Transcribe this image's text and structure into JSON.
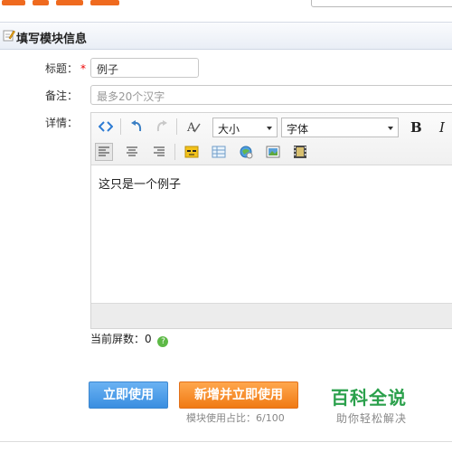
{
  "section": {
    "title": "填写模块信息"
  },
  "form": {
    "title_label": "标题：",
    "required_mark": "*",
    "title_value": "例子",
    "note_label": "备注：",
    "note_placeholder": "最多20个汉字",
    "detail_label": "详情："
  },
  "editor": {
    "size_select": "大小",
    "font_select": "字体",
    "bold": "B",
    "italic": "I",
    "content": "这只是一个例子",
    "icons": [
      "source-icon",
      "undo-icon",
      "redo-icon",
      "clear-format-icon",
      "align-left-icon",
      "align-center-icon",
      "align-right-icon",
      "emoticon-icon",
      "table-icon",
      "image-icon",
      "picture-icon",
      "video-icon"
    ]
  },
  "status": {
    "screens_label": "当前屏数：",
    "screens_value": "0",
    "help": "?"
  },
  "actions": {
    "use_now": "立即使用",
    "add_and_use": "新增并立即使用",
    "usage": "模块使用占比：6/100"
  },
  "watermark": {
    "title": "百科全说",
    "subtitle": "助你轻松解决"
  },
  "colors": {
    "primary_blue": "#3a8ee0",
    "accent_orange": "#f07a14",
    "watermark_green": "#2aa04b",
    "required_red": "#ee0000"
  }
}
